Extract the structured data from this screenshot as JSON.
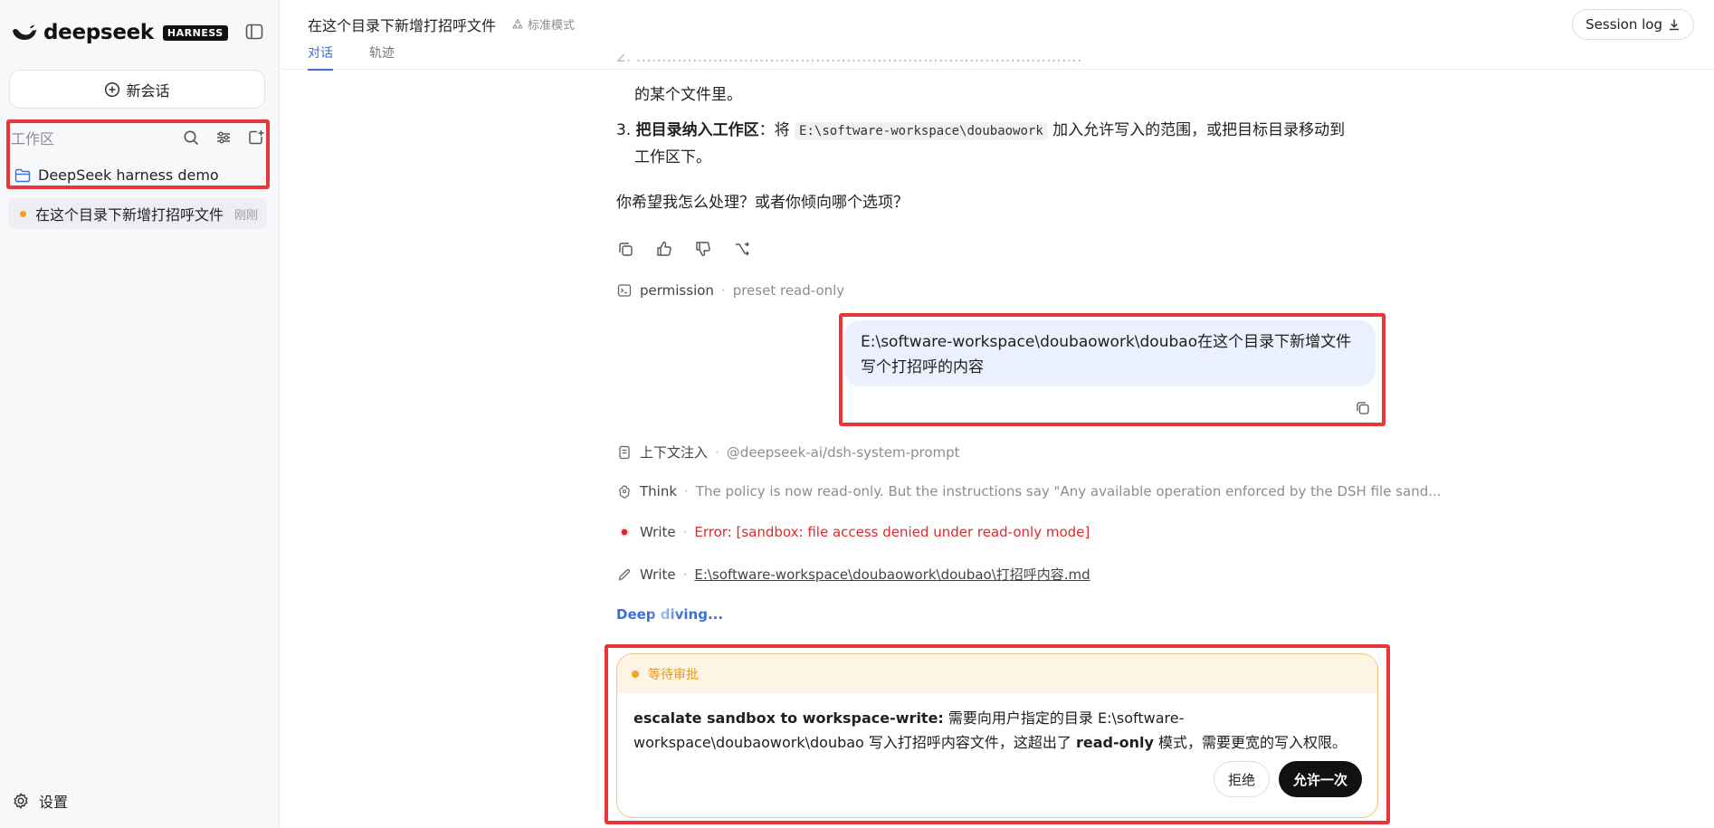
{
  "sidebar": {
    "brand_name": "deepseek",
    "brand_badge": "HARNESS",
    "new_chat_label": "新会话",
    "workspace_label": "工作区",
    "workspace_item": "DeepSeek harness demo",
    "session": {
      "title": "在这个目录下新增打招呼文件",
      "time": "刚刚"
    },
    "settings_label": "设置"
  },
  "header": {
    "title": "在这个目录下新增打招呼文件",
    "mode": "标准模式",
    "tabs": [
      "对话",
      "轨迹"
    ],
    "session_log_label": "Session log"
  },
  "conversation": {
    "item2_tail": "的某个文件里。",
    "item3_num": "3.",
    "item3_bold": "把目录纳入工作区",
    "item3_pre": "：将",
    "item3_code": "E:\\software-workspace\\doubaowork",
    "item3_post": "加入允许写入的范围，或把目标目录移动到",
    "item3_line2": "工作区下。",
    "question": "你希望我怎么处理？或者你倾向哪个选项？",
    "permission": {
      "kind": "permission",
      "detail": "preset read-only"
    },
    "user_message": "E:\\software-workspace\\doubaowork\\doubao在这个目录下新增文件写个打招呼的内容",
    "steps": [
      {
        "kind": "上下文注入",
        "detail": "@deepseek-ai/dsh-system-prompt"
      },
      {
        "kind": "Think",
        "detail": "The policy is now read-only. But the instructions say \"Any available operation enforced by the DSH file sand..."
      },
      {
        "kind": "Write",
        "detail": "Error: [sandbox: file access denied under read-only mode]"
      },
      {
        "kind": "Write",
        "detail": "E:\\software-workspace\\doubaowork\\doubao\\打招呼内容.md"
      }
    ],
    "status": "Deep diving..."
  },
  "approval": {
    "status": "等待审批",
    "title": "escalate sandbox to workspace-write:",
    "text_1": " 需要向用户指定的目录 ",
    "path_a": "E:\\software-",
    "path_b": "workspace\\doubaowork\\doubao",
    "text_2": " 写入打招呼内容文件，这超出了 ",
    "mode": "read-only",
    "text_3": " 模式，需要更宽的写入权限。",
    "reject_label": "拒绝",
    "allow_label": "允许一次"
  },
  "colors": {
    "accent": "#3b6fd8",
    "highlight_box": "#e8363b",
    "error": "#e0282e",
    "pending": "#f5a020",
    "user_bubble": "#eaf0fd"
  }
}
